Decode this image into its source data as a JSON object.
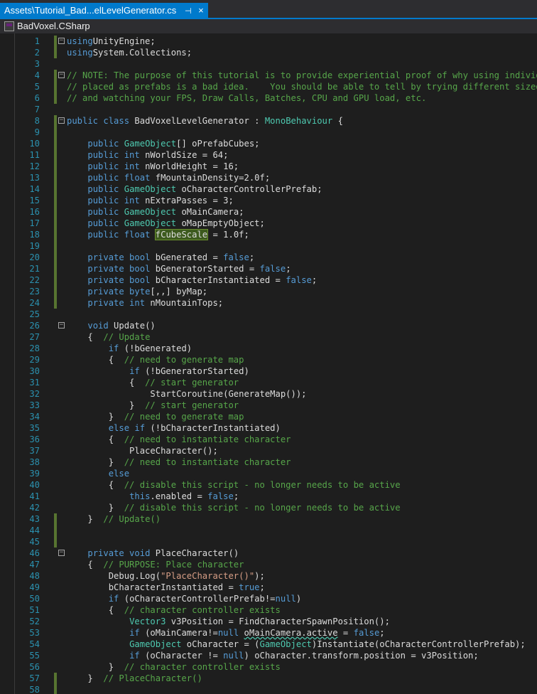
{
  "tab": {
    "title": "Assets\\Tutorial_Bad...elLevelGenerator.cs",
    "pin_glyph": "⊣",
    "close_glyph": "×"
  },
  "navbar": {
    "project": "BadVoxel.CSharp"
  },
  "icons": {
    "project": "csharp-project-icon",
    "fold": "collapse-icon"
  },
  "colors": {
    "accent": "#007acc",
    "keyword": "#569cd6",
    "comment": "#57a64a",
    "string": "#d69d85",
    "type": "#4ec9b0",
    "line_number": "#2b91af",
    "change_bar": "#577430"
  },
  "lines": [
    {
      "n": "1",
      "segs": [
        [
          "kw",
          "using"
        ],
        [
          "",
          "UnityEngine;"
        ]
      ],
      "fold": true,
      "chg": true
    },
    {
      "n": "2",
      "segs": [
        [
          "kw",
          "using"
        ],
        [
          "",
          "System.Collections;"
        ]
      ],
      "chg": true
    },
    {
      "n": "3",
      "segs": []
    },
    {
      "n": "4",
      "segs": [
        [
          "cm",
          "// NOTE: The purpose of this tutorial is to provide experiential proof of why using individual"
        ]
      ],
      "fold": true,
      "chg": true
    },
    {
      "n": "5",
      "segs": [
        [
          "cm",
          "// placed as prefabs is a bad idea.    You should be able to tell by trying different sized map"
        ]
      ],
      "chg": true
    },
    {
      "n": "6",
      "segs": [
        [
          "cm",
          "// and watching your FPS, Draw Calls, Batches, CPU and GPU load, etc."
        ]
      ],
      "chg": true
    },
    {
      "n": "7",
      "segs": []
    },
    {
      "n": "8",
      "segs": [
        [
          "kw",
          "public class"
        ],
        [
          "",
          " BadVoxelLevelGenerator : "
        ],
        [
          "ty",
          "MonoBehaviour"
        ],
        [
          "",
          " {"
        ]
      ],
      "fold": true,
      "chg": true
    },
    {
      "n": "9",
      "segs": [],
      "chg": true
    },
    {
      "n": "10",
      "segs": [
        [
          "",
          "    "
        ],
        [
          "kw",
          "public"
        ],
        [
          "",
          ""
        ],
        [
          "ty",
          " GameObject"
        ],
        [
          "",
          "[] oPrefabCubes;"
        ]
      ],
      "chg": true
    },
    {
      "n": "11",
      "segs": [
        [
          "",
          "    "
        ],
        [
          "kw",
          "public int"
        ],
        [
          "",
          " nWorldSize = 64;"
        ]
      ],
      "chg": true
    },
    {
      "n": "12",
      "segs": [
        [
          "",
          "    "
        ],
        [
          "kw",
          "public int"
        ],
        [
          "",
          " nWorldHeight = 16;"
        ]
      ],
      "chg": true
    },
    {
      "n": "13",
      "segs": [
        [
          "",
          "    "
        ],
        [
          "kw",
          "public float"
        ],
        [
          "",
          " fMountainDensity=2.0f;"
        ]
      ],
      "chg": true
    },
    {
      "n": "14",
      "segs": [
        [
          "",
          "    "
        ],
        [
          "kw",
          "public"
        ],
        [
          "ty",
          " GameObject"
        ],
        [
          "",
          " oCharacterControllerPrefab;"
        ]
      ],
      "chg": true
    },
    {
      "n": "15",
      "segs": [
        [
          "",
          "    "
        ],
        [
          "kw",
          "public int"
        ],
        [
          "",
          " nExtraPasses = 3;"
        ]
      ],
      "chg": true
    },
    {
      "n": "16",
      "segs": [
        [
          "",
          "    "
        ],
        [
          "kw",
          "public"
        ],
        [
          "ty",
          " GameObject"
        ],
        [
          "",
          " oMainCamera;"
        ]
      ],
      "chg": true
    },
    {
      "n": "17",
      "segs": [
        [
          "",
          "    "
        ],
        [
          "kw",
          "public"
        ],
        [
          "ty",
          " GameObject"
        ],
        [
          "",
          " oMapEmptyObject;"
        ]
      ],
      "chg": true
    },
    {
      "n": "18",
      "segs": [
        [
          "",
          "    "
        ],
        [
          "kw",
          "public float"
        ],
        [
          "",
          "",
          " "
        ],
        [
          "hl",
          "fCubeScale"
        ],
        [
          "",
          " = 1.0f;"
        ]
      ],
      "chg": true
    },
    {
      "n": "19",
      "segs": [],
      "chg": true
    },
    {
      "n": "20",
      "segs": [
        [
          "",
          "    "
        ],
        [
          "kw",
          "private bool"
        ],
        [
          "",
          " bGenerated = "
        ],
        [
          "kw",
          "false"
        ],
        [
          "",
          ";"
        ]
      ],
      "chg": true
    },
    {
      "n": "21",
      "segs": [
        [
          "",
          "    "
        ],
        [
          "kw",
          "private bool"
        ],
        [
          "",
          " bGeneratorStarted = "
        ],
        [
          "kw",
          "false"
        ],
        [
          "",
          ";"
        ]
      ],
      "chg": true
    },
    {
      "n": "22",
      "segs": [
        [
          "",
          "    "
        ],
        [
          "kw",
          "private bool"
        ],
        [
          "",
          " bCharacterInstantiated = "
        ],
        [
          "kw",
          "false"
        ],
        [
          "",
          ";"
        ]
      ],
      "chg": true
    },
    {
      "n": "23",
      "segs": [
        [
          "",
          "    "
        ],
        [
          "kw",
          "private byte"
        ],
        [
          "",
          "[,,] byMap;"
        ]
      ],
      "chg": true
    },
    {
      "n": "24",
      "segs": [
        [
          "",
          "    "
        ],
        [
          "kw",
          "private int"
        ],
        [
          "",
          " nMountainTops;"
        ]
      ],
      "chg": true
    },
    {
      "n": "25",
      "segs": []
    },
    {
      "n": "26",
      "segs": [
        [
          "",
          "    "
        ],
        [
          "kw",
          "void"
        ],
        [
          "",
          " Update()"
        ]
      ],
      "fold": true
    },
    {
      "n": "27",
      "segs": [
        [
          "",
          "    {  "
        ],
        [
          "cm",
          "// Update"
        ]
      ]
    },
    {
      "n": "28",
      "segs": [
        [
          "",
          "        "
        ],
        [
          "kw",
          "if"
        ],
        [
          "",
          " (!bGenerated)"
        ]
      ]
    },
    {
      "n": "29",
      "segs": [
        [
          "",
          "        {  "
        ],
        [
          "cm",
          "// need to generate map"
        ]
      ]
    },
    {
      "n": "30",
      "segs": [
        [
          "",
          "            "
        ],
        [
          "kw",
          "if"
        ],
        [
          "",
          " (!bGeneratorStarted)"
        ]
      ]
    },
    {
      "n": "31",
      "segs": [
        [
          "",
          "            {  "
        ],
        [
          "cm",
          "// start generator"
        ]
      ]
    },
    {
      "n": "32",
      "segs": [
        [
          "",
          "                StartCoroutine(GenerateMap());"
        ]
      ]
    },
    {
      "n": "33",
      "segs": [
        [
          "",
          "            }  "
        ],
        [
          "cm",
          "// start generator"
        ]
      ]
    },
    {
      "n": "34",
      "segs": [
        [
          "",
          "        }  "
        ],
        [
          "cm",
          "// need to generate map"
        ]
      ]
    },
    {
      "n": "35",
      "segs": [
        [
          "",
          "        "
        ],
        [
          "kw",
          "else if"
        ],
        [
          "",
          " (!bCharacterInstantiated)"
        ]
      ]
    },
    {
      "n": "36",
      "segs": [
        [
          "",
          "        {  "
        ],
        [
          "cm",
          "// need to instantiate character"
        ]
      ]
    },
    {
      "n": "37",
      "segs": [
        [
          "",
          "            PlaceCharacter();"
        ]
      ]
    },
    {
      "n": "38",
      "segs": [
        [
          "",
          "        }  "
        ],
        [
          "cm",
          "// need to instantiate character"
        ]
      ]
    },
    {
      "n": "39",
      "segs": [
        [
          "",
          "        "
        ],
        [
          "kw",
          "else"
        ]
      ]
    },
    {
      "n": "40",
      "segs": [
        [
          "",
          "        {  "
        ],
        [
          "cm",
          "// disable this script - no longer needs to be active"
        ]
      ]
    },
    {
      "n": "41",
      "segs": [
        [
          "",
          "            "
        ],
        [
          "kw",
          "this"
        ],
        [
          "",
          ".enabled = "
        ],
        [
          "kw",
          "false"
        ],
        [
          "",
          ";"
        ]
      ]
    },
    {
      "n": "42",
      "segs": [
        [
          "",
          "        }  "
        ],
        [
          "cm",
          "// disable this script - no longer needs to be active"
        ]
      ]
    },
    {
      "n": "43",
      "segs": [
        [
          "",
          "    }  "
        ],
        [
          "cm",
          "// Update()"
        ]
      ],
      "chg": true
    },
    {
      "n": "44",
      "segs": [],
      "chg": true
    },
    {
      "n": "45",
      "segs": [],
      "chg": true
    },
    {
      "n": "46",
      "segs": [
        [
          "",
          "    "
        ],
        [
          "kw",
          "private void"
        ],
        [
          "",
          " PlaceCharacter()"
        ]
      ],
      "fold": true
    },
    {
      "n": "47",
      "segs": [
        [
          "",
          "    {  "
        ],
        [
          "cm",
          "// PURPOSE: Place character"
        ]
      ]
    },
    {
      "n": "48",
      "segs": [
        [
          "",
          "        Debug.Log("
        ],
        [
          "st",
          "\"PlaceCharacter()\""
        ],
        [
          "",
          ");"
        ]
      ]
    },
    {
      "n": "49",
      "segs": [
        [
          "",
          "        bCharacterInstantiated = "
        ],
        [
          "kw",
          "true"
        ],
        [
          "",
          ";"
        ]
      ]
    },
    {
      "n": "50",
      "segs": [
        [
          "",
          "        "
        ],
        [
          "kw",
          "if"
        ],
        [
          "",
          " (oCharacterControllerPrefab!="
        ],
        [
          "kw",
          "null"
        ],
        [
          "",
          ")"
        ]
      ]
    },
    {
      "n": "51",
      "segs": [
        [
          "",
          "        {  "
        ],
        [
          "cm",
          "// character controller exists"
        ]
      ]
    },
    {
      "n": "52",
      "segs": [
        [
          "",
          "            "
        ],
        [
          "ty",
          "Vector3"
        ],
        [
          "",
          " v3Position = FindCharacterSpawnPosition();"
        ]
      ]
    },
    {
      "n": "53",
      "segs": [
        [
          "",
          "            "
        ],
        [
          "kw",
          "if"
        ],
        [
          "",
          " (oMainCamera!="
        ],
        [
          "kw",
          "null"
        ],
        [
          "",
          " "
        ],
        [
          "squig",
          "oMainCamera.active"
        ],
        [
          "",
          " = "
        ],
        [
          "kw",
          "false"
        ],
        [
          "",
          ";"
        ]
      ]
    },
    {
      "n": "54",
      "segs": [
        [
          "",
          "            "
        ],
        [
          "ty",
          "GameObject"
        ],
        [
          "",
          " oCharacter = ("
        ],
        [
          "ty",
          "GameObject"
        ],
        [
          "",
          ")Instantiate(oCharacterControllerPrefab);"
        ]
      ]
    },
    {
      "n": "55",
      "segs": [
        [
          "",
          "            "
        ],
        [
          "kw",
          "if"
        ],
        [
          "",
          " (oCharacter != "
        ],
        [
          "kw",
          "null"
        ],
        [
          "",
          ") oCharacter.transform.position = v3Position;"
        ]
      ]
    },
    {
      "n": "56",
      "segs": [
        [
          "",
          "        }  "
        ],
        [
          "cm",
          "// character controller exists"
        ]
      ]
    },
    {
      "n": "57",
      "segs": [
        [
          "",
          "    }  "
        ],
        [
          "cm",
          "// PlaceCharacter()"
        ]
      ],
      "chg": true
    },
    {
      "n": "58",
      "segs": [],
      "chg": true
    }
  ]
}
